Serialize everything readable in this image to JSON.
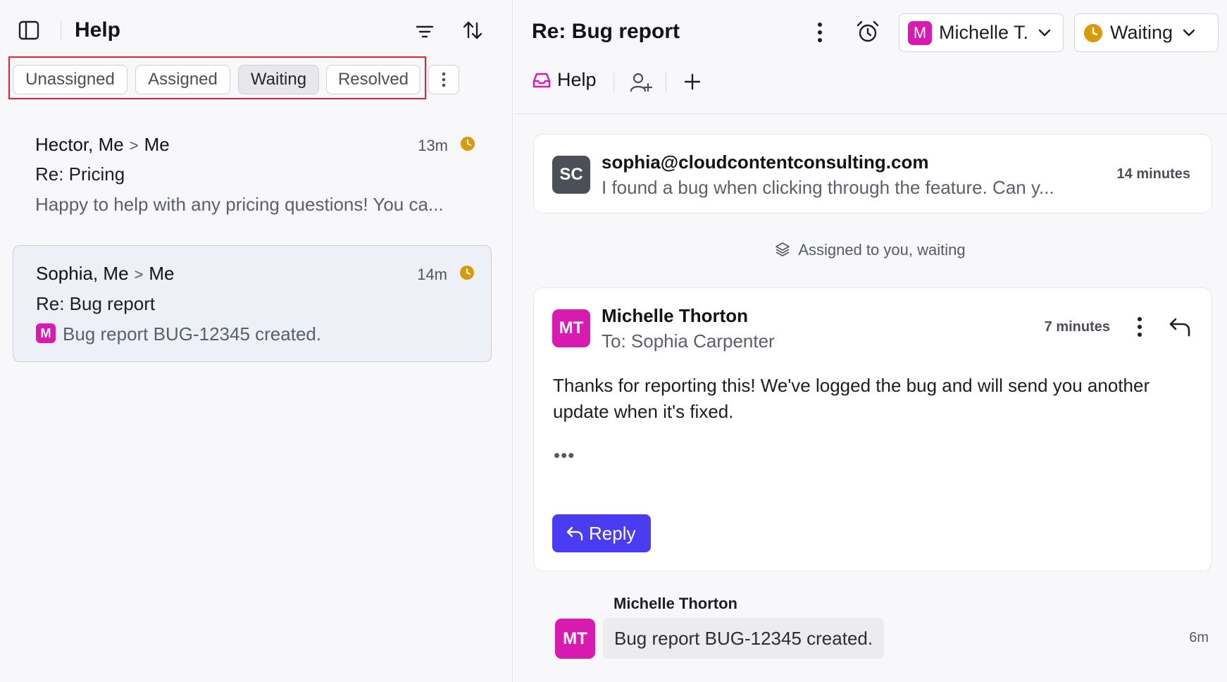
{
  "sidebar_panel": {
    "title": "Help",
    "filters": [
      {
        "label": "Unassigned",
        "active": false
      },
      {
        "label": "Assigned",
        "active": false
      },
      {
        "label": "Waiting",
        "active": true
      },
      {
        "label": "Resolved",
        "active": false
      }
    ],
    "conversations": [
      {
        "from": "Hector, Me",
        "to": "Me",
        "time": "13m",
        "subject": "Re: Pricing",
        "preview": "Happy to help with any pricing questions! You ca...",
        "selected": false
      },
      {
        "from": "Sophia, Me",
        "to": "Me",
        "time": "14m",
        "subject": "Re: Bug report",
        "preview_avatar": "M",
        "preview": "Bug report BUG-12345 created.",
        "selected": true
      }
    ]
  },
  "conversation": {
    "title": "Re: Bug report",
    "assignee": {
      "avatar": "M",
      "name": "Michelle T."
    },
    "status": "Waiting",
    "inbox_tab": "Help",
    "messages": [
      {
        "avatar": "SC",
        "from": "sophia@cloudcontentconsulting.com",
        "snippet": "I found a bug when clicking through the feature. Can y...",
        "time": "14 minutes"
      },
      {
        "avatar": "MT",
        "from": "Michelle Thorton",
        "to": "To: Sophia Carpenter",
        "time": "7 minutes",
        "body": "Thanks for reporting this! We've logged the bug and will send you another update when it's fixed.",
        "ellipsis": "•••",
        "reply_label": "Reply"
      }
    ],
    "event": "Assigned to you, waiting",
    "note": {
      "author": "Michelle Thorton",
      "avatar": "MT",
      "text": "Bug report BUG-12345 created.",
      "time": "6m"
    }
  },
  "colors": {
    "accent": "#4a3cf0",
    "avatar_pink": "#d91ab0",
    "avatar_gray": "#4b4f57",
    "waiting_amber": "#d99a0a",
    "highlight_red": "#e8202a"
  },
  "icons": [
    "sidebar-toggle-icon",
    "filter-icon",
    "sort-icon",
    "more-vertical-icon",
    "snooze-alarm-icon",
    "chevron-down-icon",
    "clock-icon",
    "inbox-icon",
    "add-user-icon",
    "plus-icon",
    "layers-icon",
    "reply-icon"
  ]
}
